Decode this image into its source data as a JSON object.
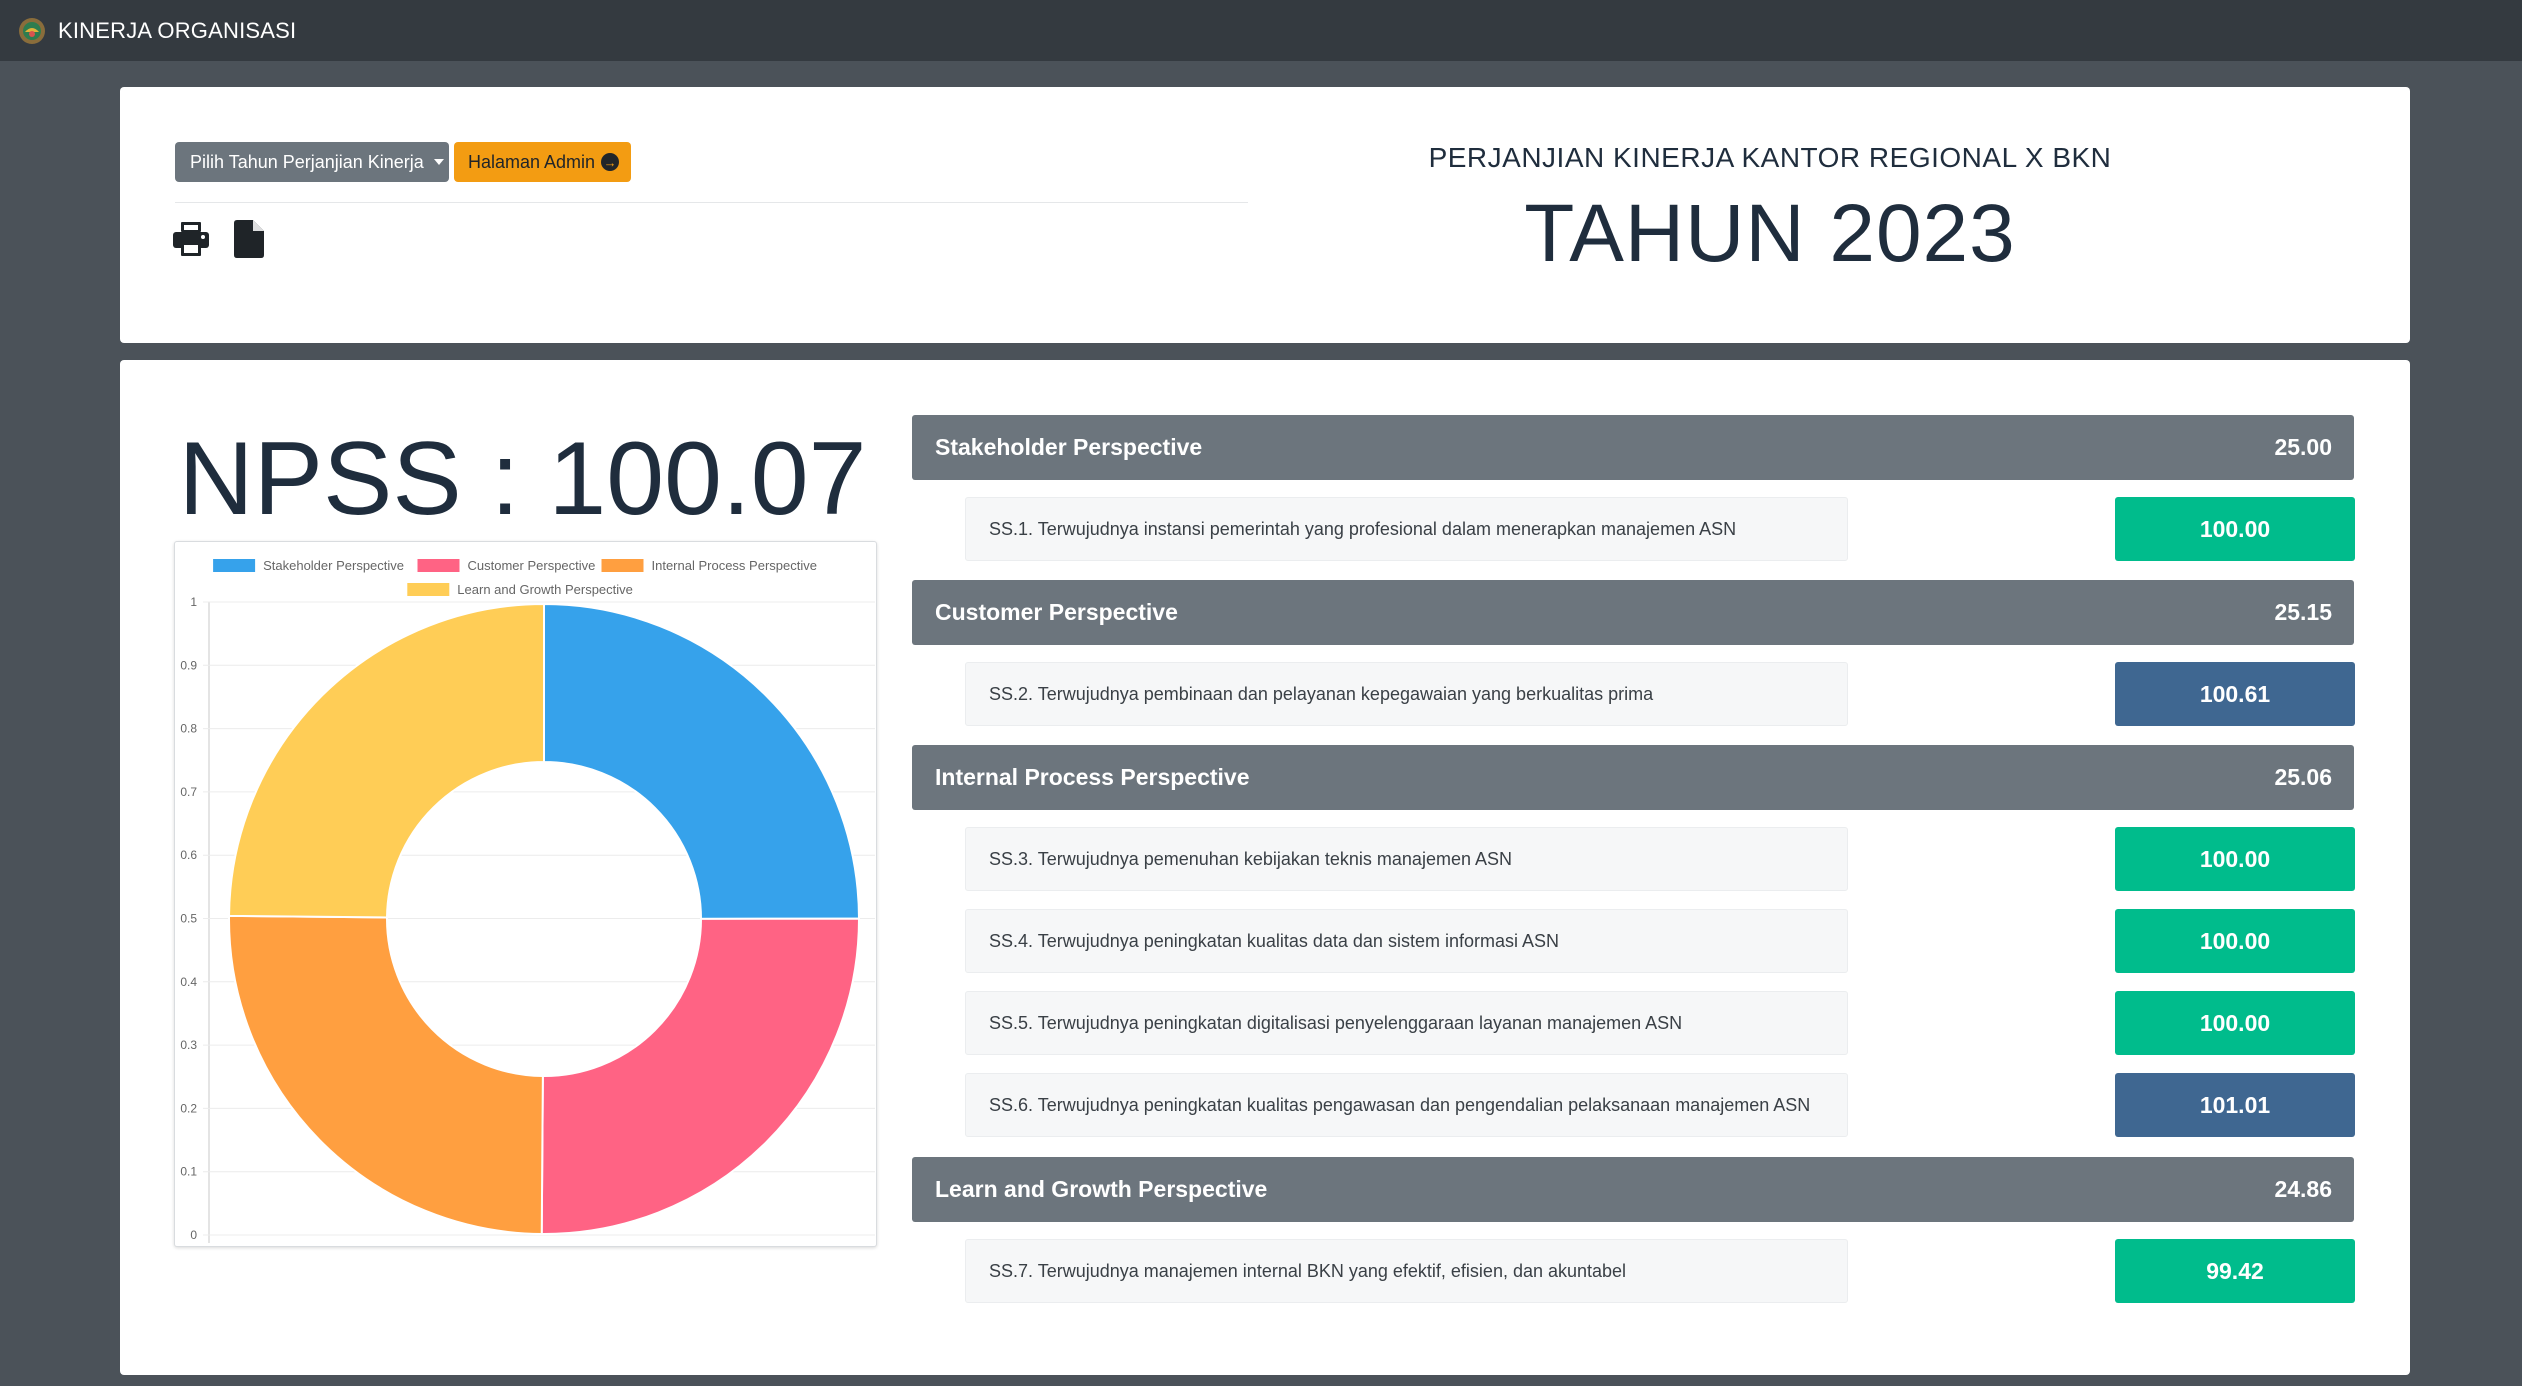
{
  "navbar": {
    "brand": "KINERJA ORGANISASI",
    "logo_icon": "bkn-logo-icon"
  },
  "top": {
    "year_dropdown_label": "Pilih Tahun Perjanjian Kinerja",
    "admin_button_label": "Halaman Admin",
    "print_icon": "print-icon",
    "file_icon": "file-icon",
    "subtitle": "PERJANJIAN KINERJA KANTOR REGIONAL X BKN",
    "year_title": "TAHUN 2023"
  },
  "main": {
    "npss": "NPSS : 100.07",
    "perspectives": [
      {
        "name": "Stakeholder Perspective",
        "score": "25.00",
        "items": [
          {
            "text": "SS.1. Terwujudnya instansi pemerintah yang profesional dalam menerapkan manajemen ASN",
            "value": "100.00",
            "status": "green"
          }
        ]
      },
      {
        "name": "Customer Perspective",
        "score": "25.15",
        "items": [
          {
            "text": "SS.2. Terwujudnya pembinaan dan pelayanan kepegawaian yang berkualitas prima",
            "value": "100.61",
            "status": "blue"
          }
        ]
      },
      {
        "name": "Internal Process Perspective",
        "score": "25.06",
        "items": [
          {
            "text": "SS.3. Terwujudnya pemenuhan kebijakan teknis manajemen ASN",
            "value": "100.00",
            "status": "green"
          },
          {
            "text": "SS.4. Terwujudnya peningkatan kualitas data dan sistem informasi ASN",
            "value": "100.00",
            "status": "green"
          },
          {
            "text": "SS.5. Terwujudnya peningkatan digitalisasi penyelenggaraan layanan manajemen ASN",
            "value": "100.00",
            "status": "green"
          },
          {
            "text": "SS.6. Terwujudnya peningkatan kualitas pengawasan dan pengendalian pelaksanaan manajemen ASN",
            "value": "101.01",
            "status": "blue"
          }
        ]
      },
      {
        "name": "Learn and Growth Perspective",
        "score": "24.86",
        "items": [
          {
            "text": "SS.7. Terwujudnya manajemen internal BKN yang efektif, efisien, dan akuntabel",
            "value": "99.42",
            "status": "green"
          }
        ]
      }
    ],
    "status_colors": {
      "green": "#00bc8c",
      "blue": "#3f6791"
    }
  },
  "chart_data": {
    "type": "pie",
    "subtype": "doughnut",
    "labels": [
      "Stakeholder Perspective",
      "Customer Perspective",
      "Internal Process Perspective",
      "Learn and Growth Perspective"
    ],
    "values": [
      25.0,
      25.15,
      25.06,
      24.86
    ],
    "colors": [
      "#36a2eb",
      "#ff6384",
      "#ff9f40",
      "#ffcd56"
    ],
    "y_axis_ticks": [
      "0",
      "0.1",
      "0.2",
      "0.3",
      "0.4",
      "0.5",
      "0.6",
      "0.7",
      "0.8",
      "0.9",
      "1"
    ],
    "legend_position": "top",
    "grid": true
  }
}
